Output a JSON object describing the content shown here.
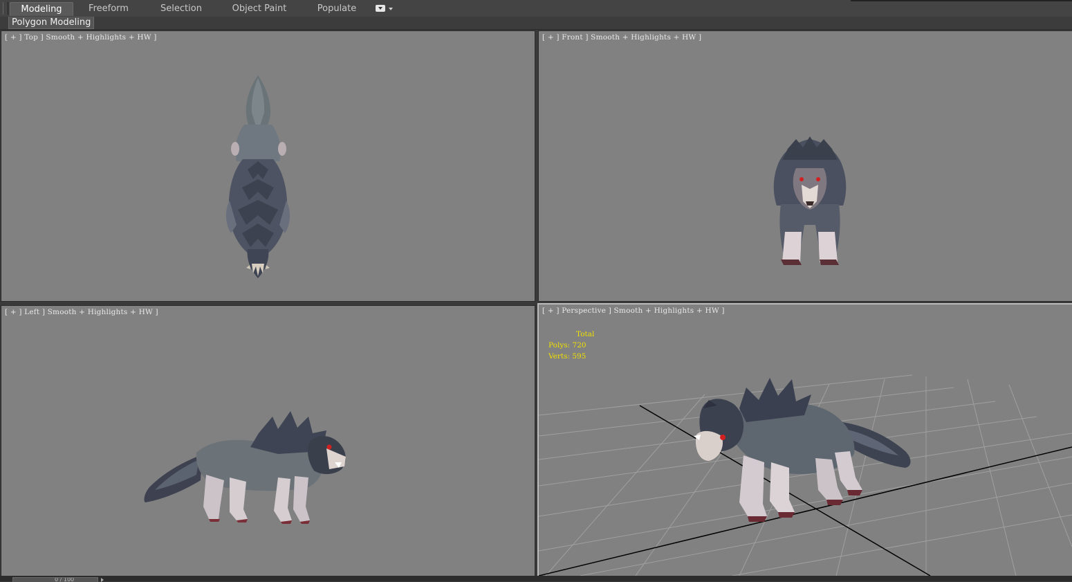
{
  "ribbon": {
    "tabs": [
      {
        "label": "Modeling",
        "active": true
      },
      {
        "label": "Freeform",
        "active": false
      },
      {
        "label": "Selection",
        "active": false
      },
      {
        "label": "Object Paint",
        "active": false
      },
      {
        "label": "Populate",
        "active": false
      }
    ],
    "panel_label": "Polygon Modeling"
  },
  "viewports": {
    "top": {
      "label": "[ + ] Top ] Smooth + Highlights + HW ]"
    },
    "front": {
      "label": "[ + ] Front ] Smooth + Highlights + HW ]"
    },
    "left": {
      "label": "[ + ] Left ] Smooth + Highlights + HW ]"
    },
    "perspective": {
      "label": "[ + ] Perspective ] Smooth + Highlights + HW ]",
      "stats": {
        "header": "Total",
        "polys_label": "Polys:",
        "polys_value": "720",
        "verts_label": "Verts:",
        "verts_value": "595"
      }
    }
  },
  "time_slider": {
    "text": "0 / 100"
  },
  "colors": {
    "viewport_bg": "#818181",
    "stats_text": "#f0e000",
    "label_text": "#e8e8e8",
    "wolf_fur": "#4d5360",
    "wolf_light": "#d8cdd0"
  },
  "icons": [
    "ribbon-options-icon",
    "dropdown-arrow-icon",
    "wolf-model"
  ]
}
